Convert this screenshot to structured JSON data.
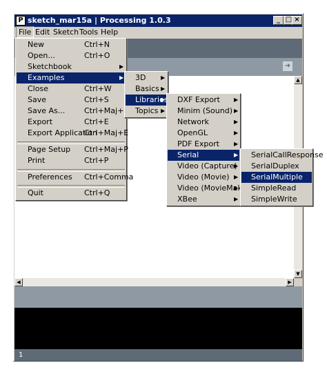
{
  "window": {
    "title": "sketch_mar15a | Processing 1.0.3",
    "icon_letter": "P",
    "buttons": [
      "_",
      "□",
      "×"
    ]
  },
  "menubar": [
    "File",
    "Edit",
    "Sketch",
    "Tools",
    "Help"
  ],
  "file_menu": [
    {
      "label": "New",
      "shortcut": "Ctrl+N"
    },
    {
      "label": "Open...",
      "shortcut": "Ctrl+O"
    },
    {
      "label": "Sketchbook",
      "shortcut": "",
      "submenu": true
    },
    {
      "label": "Examples",
      "shortcut": "",
      "submenu": true,
      "selected": true
    },
    {
      "label": "Close",
      "shortcut": "Ctrl+W"
    },
    {
      "label": "Save",
      "shortcut": "Ctrl+S"
    },
    {
      "label": "Save As...",
      "shortcut": "Ctrl+Maj+S"
    },
    {
      "label": "Export",
      "shortcut": "Ctrl+E"
    },
    {
      "label": "Export Application",
      "shortcut": "Ctrl+Maj+E"
    },
    {
      "label": "Page Setup",
      "shortcut": "Ctrl+Maj+P"
    },
    {
      "label": "Print",
      "shortcut": "Ctrl+P"
    },
    {
      "label": "Preferences",
      "shortcut": "Ctrl+Comma"
    },
    {
      "label": "Quit",
      "shortcut": "Ctrl+Q"
    }
  ],
  "examples_menu": [
    {
      "label": "3D",
      "submenu": true
    },
    {
      "label": "Basics",
      "submenu": true
    },
    {
      "label": "Libraries",
      "submenu": true,
      "selected": true
    },
    {
      "label": "Topics",
      "submenu": true
    }
  ],
  "libraries_menu": [
    {
      "label": "DXF Export",
      "submenu": true
    },
    {
      "label": "Minim (Sound)",
      "submenu": true
    },
    {
      "label": "Network",
      "submenu": true
    },
    {
      "label": "OpenGL",
      "submenu": true
    },
    {
      "label": "PDF Export",
      "submenu": true
    },
    {
      "label": "Serial",
      "submenu": true,
      "selected": true
    },
    {
      "label": "Video (Capture)",
      "submenu": true
    },
    {
      "label": "Video (Movie)",
      "submenu": true
    },
    {
      "label": "Video (MovieMaker)",
      "submenu": true
    },
    {
      "label": "XBee",
      "submenu": true
    }
  ],
  "serial_menu": [
    {
      "label": "SerialCallResponse"
    },
    {
      "label": "SerialDuplex"
    },
    {
      "label": "SerialMultiple",
      "selected": true
    },
    {
      "label": "SimpleRead"
    },
    {
      "label": "SimpleWrite"
    }
  ],
  "editor": {
    "tab_arrow_icon": "right-arrow-icon",
    "line_number": "1"
  },
  "colors": {
    "menu_bg": "#d4d0c8",
    "selection": "#0a246a",
    "toolbar": "#5e6b77",
    "tabbar": "#8e99a3",
    "console": "#000000"
  }
}
